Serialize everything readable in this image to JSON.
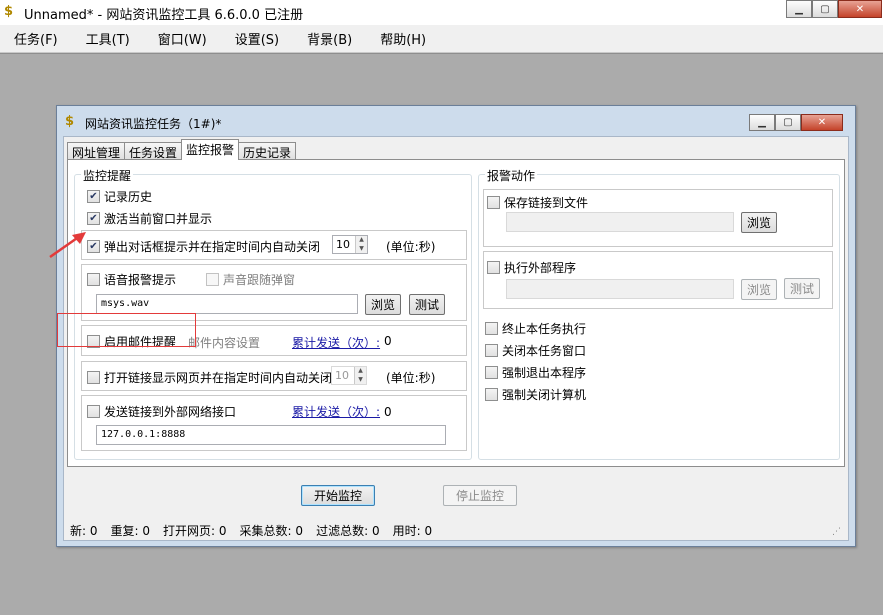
{
  "app": {
    "title": "Unnamed* - 网站资讯监控工具 6.6.0.0  已注册",
    "icon": "dollar-icon"
  },
  "menu": [
    "任务(F)",
    "工具(T)",
    "窗口(W)",
    "设置(S)",
    "背景(B)",
    "帮助(H)"
  ],
  "dialog": {
    "title": "网站资讯监控任务（1#)*",
    "tabs": [
      "网址管理",
      "任务设置",
      "监控报警",
      "历史记录"
    ],
    "active_tab": "监控报警"
  },
  "monitor": {
    "group_label": "监控提醒",
    "record_history": {
      "label": "记录历史",
      "checked": true
    },
    "activate_window": {
      "label": "激活当前窗口并显示",
      "checked": true
    },
    "popup": {
      "label": "弹出对话框提示并在指定时间内自动关闭",
      "checked": true,
      "seconds": "10",
      "unit": "(单位:秒)"
    },
    "voice": {
      "label": "语音报警提示",
      "checked": false,
      "follow_label": "声音跟随弹窗",
      "file": "msys.wav",
      "browse": "浏览",
      "test": "测试"
    },
    "email": {
      "label": "启用邮件提醒",
      "checked": false,
      "content_settings": "邮件内容设置",
      "sent_label": "累计发送（次）:",
      "sent_count": "0"
    },
    "open_link": {
      "label": "打开链接显示网页并在指定时间内自动关闭",
      "checked": false,
      "seconds": "10",
      "unit": "(单位:秒)"
    },
    "send_link": {
      "label": "发送链接到外部网络接口",
      "checked": false,
      "sent_label": "累计发送（次）:",
      "sent_count": "0",
      "endpoint": "127.0.0.1:8888"
    }
  },
  "alarm": {
    "group_label": "报警动作",
    "save_link": {
      "label": "保存链接到文件",
      "checked": false,
      "path": "",
      "browse": "浏览"
    },
    "run_program": {
      "label": "执行外部程序",
      "checked": false,
      "path": "",
      "browse": "浏览",
      "test": "测试"
    },
    "stop_task": {
      "label": "终止本任务执行",
      "checked": false
    },
    "close_window": {
      "label": "关闭本任务窗口",
      "checked": false
    },
    "exit_program": {
      "label": "强制退出本程序",
      "checked": false
    },
    "shutdown": {
      "label": "强制关闭计算机",
      "checked": false
    }
  },
  "buttons": {
    "start": "开始监控",
    "stop": "停止监控"
  },
  "status": [
    {
      "label": "新:",
      "value": "0"
    },
    {
      "label": "重复:",
      "value": "0"
    },
    {
      "label": "打开网页:",
      "value": "0"
    },
    {
      "label": "采集总数:",
      "value": "0"
    },
    {
      "label": "过滤总数:",
      "value": "0"
    },
    {
      "label": "用时:",
      "value": "0"
    }
  ],
  "colors": {
    "annotation": "#e33a3a",
    "dialog_frame": "#cddcec",
    "link": "#1a1aa6"
  }
}
